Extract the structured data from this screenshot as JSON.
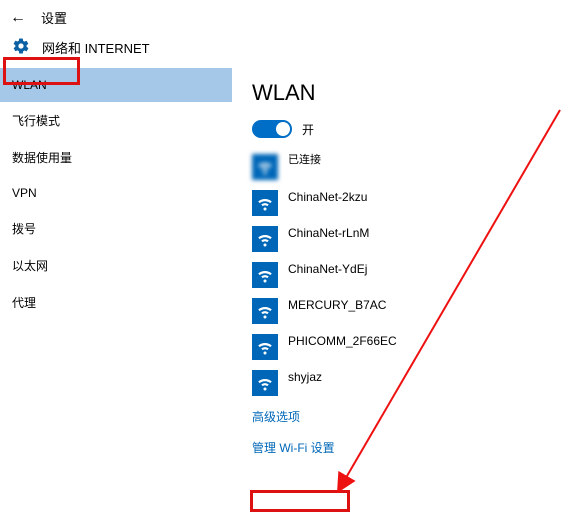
{
  "header": {
    "back_label": "返回",
    "title": "设置"
  },
  "section": {
    "icon": "gear-icon",
    "title": "网络和 INTERNET"
  },
  "sidebar": {
    "items": [
      {
        "label": "WLAN",
        "selected": true
      },
      {
        "label": "飞行模式",
        "selected": false
      },
      {
        "label": "数据使用量",
        "selected": false
      },
      {
        "label": "VPN",
        "selected": false
      },
      {
        "label": "拨号",
        "selected": false
      },
      {
        "label": "以太网",
        "selected": false
      },
      {
        "label": "代理",
        "selected": false
      }
    ]
  },
  "main": {
    "title": "WLAN",
    "toggle": {
      "on": true,
      "label": "开"
    },
    "networks": [
      {
        "name": "",
        "status": "已连接",
        "obscured": true
      },
      {
        "name": "ChinaNet-2kzu",
        "status": ""
      },
      {
        "name": "ChinaNet-rLnM",
        "status": ""
      },
      {
        "name": "ChinaNet-YdEj",
        "status": ""
      },
      {
        "name": "MERCURY_B7AC",
        "status": ""
      },
      {
        "name": "PHICOMM_2F66EC",
        "status": ""
      },
      {
        "name": "shyjaz",
        "status": ""
      }
    ],
    "links": {
      "advanced": "高级选项",
      "manage": "管理 Wi-Fi 设置"
    }
  },
  "annotations": {
    "arrow_color": "#e11"
  }
}
